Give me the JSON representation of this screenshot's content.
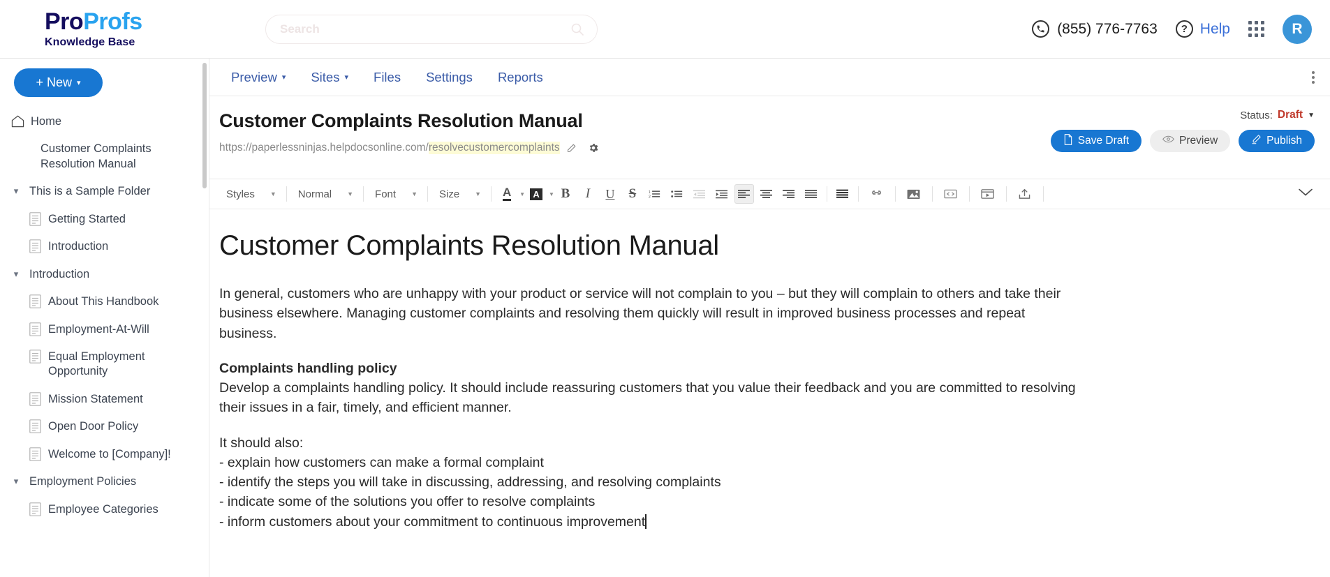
{
  "header": {
    "logo": {
      "part1": "Pro",
      "part2": "Profs",
      "subtitle": "Knowledge Base"
    },
    "search": {
      "placeholder": "Search",
      "value": "",
      "icon": "search-icon"
    },
    "phone": "(855) 776-7763",
    "help_label": "Help",
    "avatar_initial": "R",
    "apps_icon": "grid-apps-icon"
  },
  "sidebar": {
    "new_button": "+ New",
    "items": [
      {
        "label": "Home",
        "type": "home",
        "indent": 0
      },
      {
        "label": "Customer Complaints Resolution Manual",
        "type": "page-noicon",
        "indent": 1
      },
      {
        "label": "This is a Sample Folder",
        "type": "folder",
        "indent": 0
      },
      {
        "label": "Getting Started",
        "type": "page",
        "indent": 1
      },
      {
        "label": "Introduction",
        "type": "page",
        "indent": 1
      },
      {
        "label": "Introduction",
        "type": "folder",
        "indent": 0
      },
      {
        "label": "About This Handbook",
        "type": "page",
        "indent": 1
      },
      {
        "label": "Employment-At-Will",
        "type": "page",
        "indent": 1
      },
      {
        "label": "Equal Employment Opportunity",
        "type": "page",
        "indent": 1
      },
      {
        "label": "Mission Statement",
        "type": "page",
        "indent": 1
      },
      {
        "label": "Open Door Policy",
        "type": "page",
        "indent": 1
      },
      {
        "label": "Welcome to [Company]!",
        "type": "page",
        "indent": 1
      },
      {
        "label": "Employment Policies",
        "type": "folder",
        "indent": 0
      },
      {
        "label": "Employee Categories",
        "type": "page",
        "indent": 1
      }
    ]
  },
  "nav": {
    "tabs": [
      {
        "label": "Preview",
        "has_caret": true
      },
      {
        "label": "Sites",
        "has_caret": true
      },
      {
        "label": "Files",
        "has_caret": false
      },
      {
        "label": "Settings",
        "has_caret": false
      },
      {
        "label": "Reports",
        "has_caret": false
      }
    ],
    "overflow_icon": "kebab-menu-icon"
  },
  "doc": {
    "title": "Customer Complaints Resolution Manual",
    "url_base": "https://paperlessninjas.helpdocsonline.com/",
    "url_slug": "resolvecustomercomplaints",
    "status_label": "Status:",
    "status_value": "Draft",
    "buttons": {
      "save_draft": "Save Draft",
      "preview": "Preview",
      "publish": "Publish"
    }
  },
  "toolbar": {
    "selects": [
      {
        "label": "Styles"
      },
      {
        "label": "Normal"
      },
      {
        "label": "Font"
      },
      {
        "label": "Size"
      }
    ],
    "icons": [
      "text-color-icon",
      "background-color-icon",
      "bold-icon",
      "italic-icon",
      "underline-icon",
      "strikethrough-icon",
      "numbered-list-icon",
      "bulleted-list-icon",
      "decrease-indent-icon",
      "increase-indent-icon",
      "align-left-icon",
      "align-center-icon",
      "align-right-icon",
      "justify-icon",
      "line-height-icon",
      "link-icon",
      "image-icon",
      "source-code-icon",
      "video-icon",
      "upload-icon"
    ],
    "collapse_icon": "chevron-down-icon"
  },
  "editor": {
    "heading": "Customer Complaints Resolution Manual",
    "paragraph1": "In general, customers who are unhappy with your product or service will not complain to you – but they will complain to others and take their business elsewhere. Managing customer complaints and resolving them quickly will result in improved business processes and repeat business.",
    "section_heading": "Complaints handling policy",
    "paragraph2": "Develop a complaints handling policy. It should include reassuring customers that you value their feedback and you are committed to resolving their issues in a fair, timely, and efficient manner.",
    "list_intro": "It should also:",
    "list_items": [
      "- explain how customers can make a formal complaint",
      "- identify the steps you will take in discussing, addressing, and resolving complaints",
      "- indicate some of the solutions you offer to resolve complaints",
      "- inform customers about your commitment to continuous improvement"
    ]
  },
  "colors": {
    "brand_blue": "#1877d2",
    "logo_dark": "#140d5e",
    "logo_light": "#29a3ef",
    "nav_link": "#3b5ca8",
    "status_red": "#c0392b",
    "url_highlight": "#fdfbd6"
  }
}
